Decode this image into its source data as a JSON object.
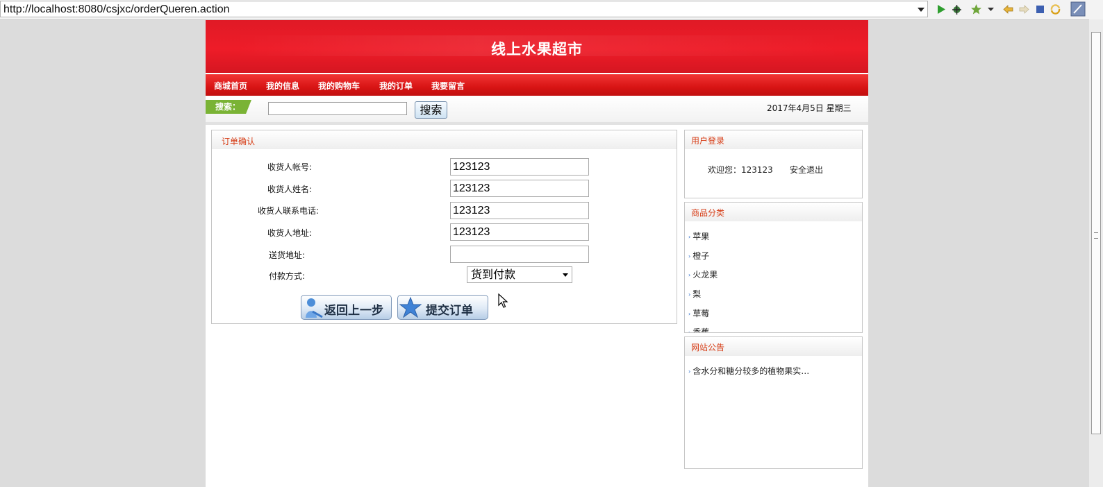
{
  "browser": {
    "url": "http://localhost:8080/csjxc/orderQueren.action"
  },
  "site": {
    "title": "线上水果超市",
    "nav": [
      "商城首页",
      "我的信息",
      "我的购物车",
      "我的订单",
      "我要留言"
    ],
    "search_label": "搜索：",
    "search_button": "搜索",
    "date": "2017年4月5日  星期三"
  },
  "order": {
    "panel_title": "订单确认",
    "fields": [
      {
        "label": "收货人帐号:",
        "value": "123123"
      },
      {
        "label": "收货人姓名:",
        "value": "123123"
      },
      {
        "label": "收货人联系电话:",
        "value": "123123"
      },
      {
        "label": "收货人地址:",
        "value": "123123"
      },
      {
        "label": "送货地址:",
        "value": ""
      }
    ],
    "payment_label": "付款方式:",
    "payment_selected": "货到付款",
    "back_button": "返回上一步",
    "submit_button": "提交订单"
  },
  "login": {
    "panel_title": "用户登录",
    "welcome": "欢迎您：123123",
    "logout": "安全退出"
  },
  "categories": {
    "panel_title": "商品分类",
    "items": [
      "苹果",
      "橙子",
      "火龙果",
      "梨",
      "草莓",
      "香蕉"
    ]
  },
  "notice": {
    "panel_title": "网站公告",
    "items": [
      "含水分和糖分较多的植物果实…"
    ]
  },
  "colors": {
    "brand_red": "#e01a26",
    "search_green": "#7ab335",
    "panel_title": "#d63b14"
  }
}
